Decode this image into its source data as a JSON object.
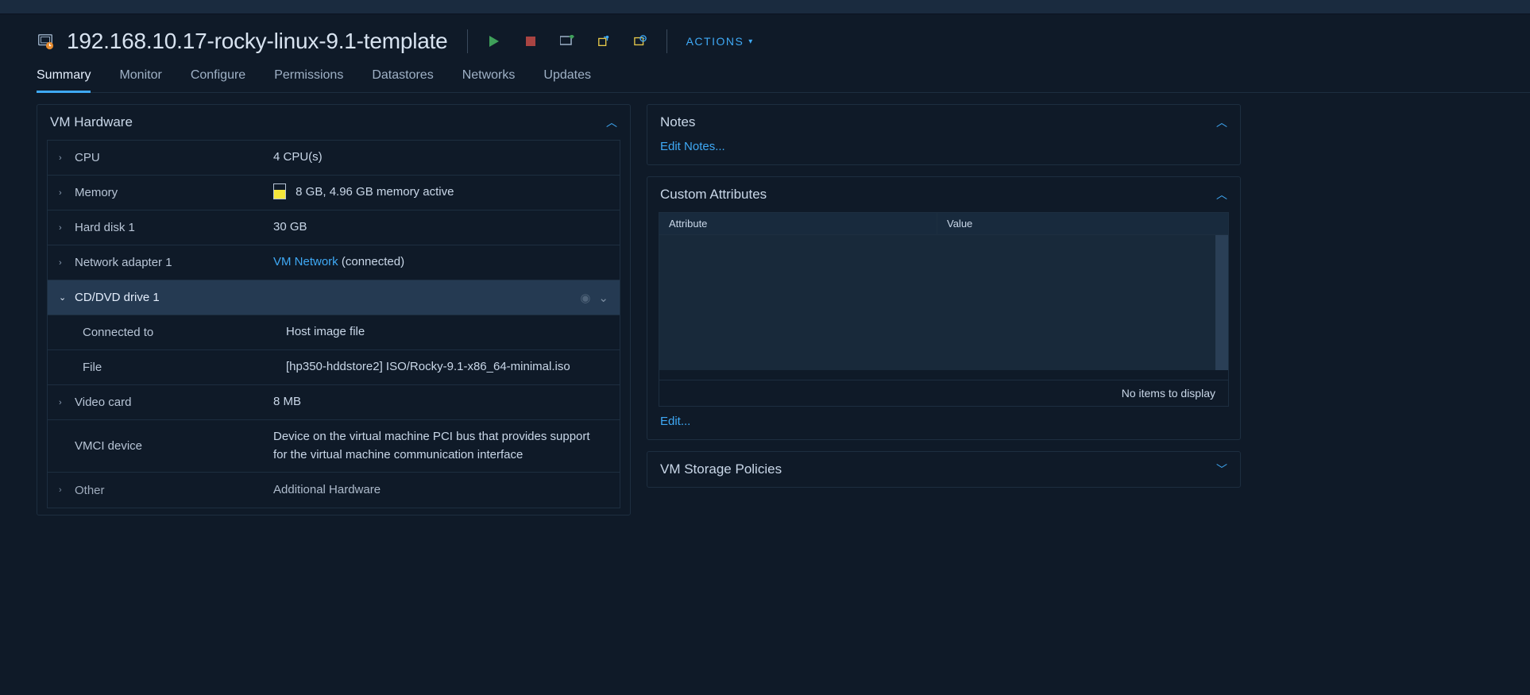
{
  "header": {
    "title": "192.168.10.17-rocky-linux-9.1-template",
    "actions_label": "ACTIONS"
  },
  "tabs": [
    {
      "label": "Summary",
      "active": true
    },
    {
      "label": "Monitor",
      "active": false
    },
    {
      "label": "Configure",
      "active": false
    },
    {
      "label": "Permissions",
      "active": false
    },
    {
      "label": "Datastores",
      "active": false
    },
    {
      "label": "Networks",
      "active": false
    },
    {
      "label": "Updates",
      "active": false
    }
  ],
  "vm_hardware": {
    "title": "VM Hardware",
    "rows": {
      "cpu": {
        "label": "CPU",
        "value": "4 CPU(s)"
      },
      "memory": {
        "label": "Memory",
        "value": "8 GB, 4.96 GB memory active"
      },
      "hard_disk": {
        "label": "Hard disk 1",
        "value": "30 GB"
      },
      "network": {
        "label": "Network adapter 1",
        "link": "VM Network",
        "suffix": " (connected)"
      },
      "cd_dvd": {
        "label": "CD/DVD drive 1"
      },
      "cd_dvd_connected_to": {
        "label": "Connected to",
        "value": "Host image file"
      },
      "cd_dvd_file": {
        "label": "File",
        "value": "[hp350-hddstore2] ISO/Rocky-9.1-x86_64-minimal.iso"
      },
      "video": {
        "label": "Video card",
        "value": "8 MB"
      },
      "vmci": {
        "label": "VMCI device",
        "value": "Device on the virtual machine PCI bus that provides support for the virtual machine communication interface"
      },
      "other": {
        "label": "Other",
        "value": "Additional Hardware"
      }
    }
  },
  "notes": {
    "title": "Notes",
    "edit_label": "Edit Notes..."
  },
  "custom_attributes": {
    "title": "Custom Attributes",
    "col_attribute": "Attribute",
    "col_value": "Value",
    "empty_text": "No items to display",
    "edit_label": "Edit..."
  },
  "storage_policies": {
    "title": "VM Storage Policies"
  }
}
